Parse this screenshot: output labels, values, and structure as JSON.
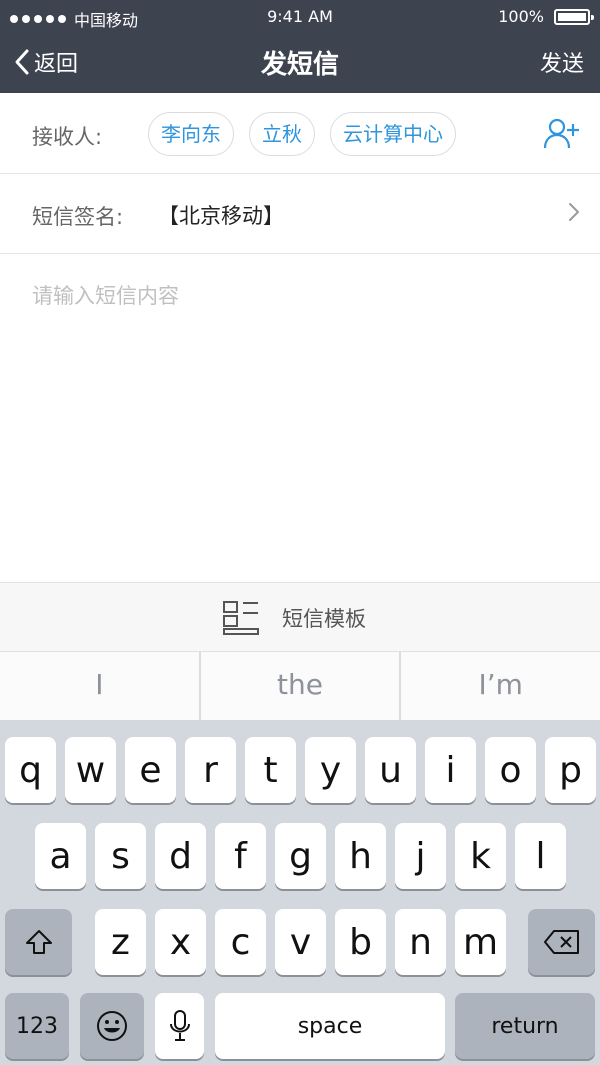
{
  "status_bar": {
    "carrier": "中国移动",
    "time": "9:41 AM",
    "battery": "100%"
  },
  "nav": {
    "back_label": "返回",
    "title": "发短信",
    "send_label": "发送"
  },
  "recipients": {
    "label": "接收人:",
    "chips": [
      "李向东",
      "立秋",
      "云计算中心"
    ]
  },
  "signature": {
    "label": "短信签名:",
    "value": "【北京移动】"
  },
  "message": {
    "placeholder": "请输入短信内容"
  },
  "template": {
    "label": "短信模板"
  },
  "suggestions": [
    "I",
    "the",
    "I’m"
  ],
  "keyboard": {
    "row1": [
      "q",
      "w",
      "e",
      "r",
      "t",
      "y",
      "u",
      "i",
      "o",
      "p"
    ],
    "row2": [
      "a",
      "s",
      "d",
      "f",
      "g",
      "h",
      "j",
      "k",
      "l"
    ],
    "row3": [
      "z",
      "x",
      "c",
      "v",
      "b",
      "n",
      "m"
    ],
    "numbers_label": "123",
    "space_label": "space",
    "return_label": "return"
  },
  "colors": {
    "nav_bg": "#3e4350",
    "accent": "#2f95dc",
    "keyboard_bg": "#d3d7de"
  }
}
